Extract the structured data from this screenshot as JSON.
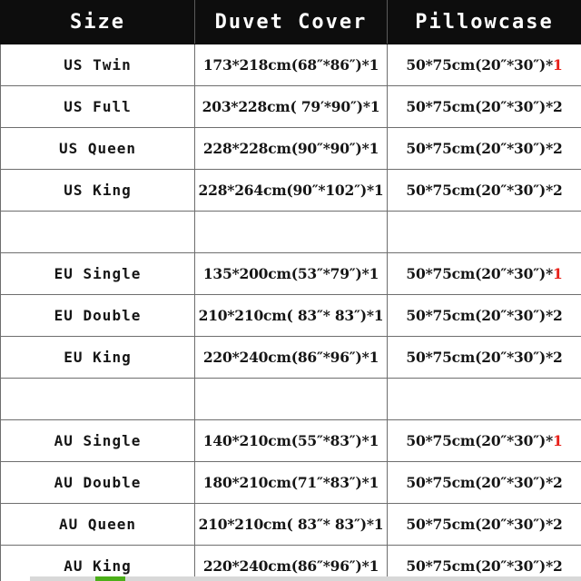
{
  "table": {
    "headers": [
      {
        "label": "Size"
      },
      {
        "label": "Duvet Cover"
      },
      {
        "label": "Pillowcase"
      }
    ],
    "rows": [
      {
        "type": "data",
        "size": "US Twin",
        "duvet": "173*218cm(68″*86″)*1",
        "pillow_text": "50*75cm(20″*30″)*",
        "pillow_qty": "1",
        "pillow_qty_red": true
      },
      {
        "type": "data",
        "size": "US Full",
        "duvet": "203*228cm( 79′*90″)*1",
        "pillow_text": "50*75cm(20″*30″)*",
        "pillow_qty": "2",
        "pillow_qty_red": false
      },
      {
        "type": "data",
        "size": "US Queen",
        "duvet": "228*228cm(90″*90″)*1",
        "pillow_text": "50*75cm(20″*30″)*",
        "pillow_qty": "2",
        "pillow_qty_red": false
      },
      {
        "type": "data",
        "size": "US King",
        "duvet": "228*264cm(90″*102″)*1",
        "pillow_text": "50*75cm(20″*30″)*",
        "pillow_qty": "2",
        "pillow_qty_red": false
      },
      {
        "type": "spacer",
        "size": "",
        "duvet": "",
        "pillow_text": "",
        "pillow_qty": "",
        "pillow_qty_red": false
      },
      {
        "type": "data",
        "size": "EU Single",
        "duvet": "135*200cm(53″*79″)*1",
        "pillow_text": "50*75cm(20″*30″)*",
        "pillow_qty": "1",
        "pillow_qty_red": true
      },
      {
        "type": "data",
        "size": "EU Double",
        "duvet": "210*210cm( 83″* 83″)*1",
        "pillow_text": "50*75cm(20″*30″)*",
        "pillow_qty": "2",
        "pillow_qty_red": false
      },
      {
        "type": "data",
        "size": "EU King",
        "duvet": "220*240cm(86″*96″)*1",
        "pillow_text": "50*75cm(20″*30″)*",
        "pillow_qty": "2",
        "pillow_qty_red": false
      },
      {
        "type": "spacer",
        "size": "",
        "duvet": "",
        "pillow_text": "",
        "pillow_qty": "",
        "pillow_qty_red": false
      },
      {
        "type": "data",
        "size": "AU Single",
        "duvet": "140*210cm(55″*83″)*1",
        "pillow_text": "50*75cm(20″*30″)*",
        "pillow_qty": "1",
        "pillow_qty_red": true
      },
      {
        "type": "data",
        "size": "AU Double",
        "duvet": "180*210cm(71″*83″)*1",
        "pillow_text": "50*75cm(20″*30″)*",
        "pillow_qty": "2",
        "pillow_qty_red": false
      },
      {
        "type": "data",
        "size": "AU Queen",
        "duvet": "210*210cm( 83″* 83″)*1",
        "pillow_text": "50*75cm(20″*30″)*",
        "pillow_qty": "2",
        "pillow_qty_red": false
      },
      {
        "type": "data",
        "size": "AU King",
        "duvet": "220*240cm(86″*96″)*1",
        "pillow_text": "50*75cm(20″*30″)*",
        "pillow_qty": "2",
        "pillow_qty_red": false
      }
    ]
  },
  "colors": {
    "header_background": "#0d0d0d",
    "header_text": "#ffffff",
    "cell_text": "#151515",
    "grid_line": "#6e6e6e",
    "highlight_quantity": "#e8211a",
    "scrollbar_track": "#d8d8d8",
    "scrollbar_thumb": "#4caf19"
  }
}
